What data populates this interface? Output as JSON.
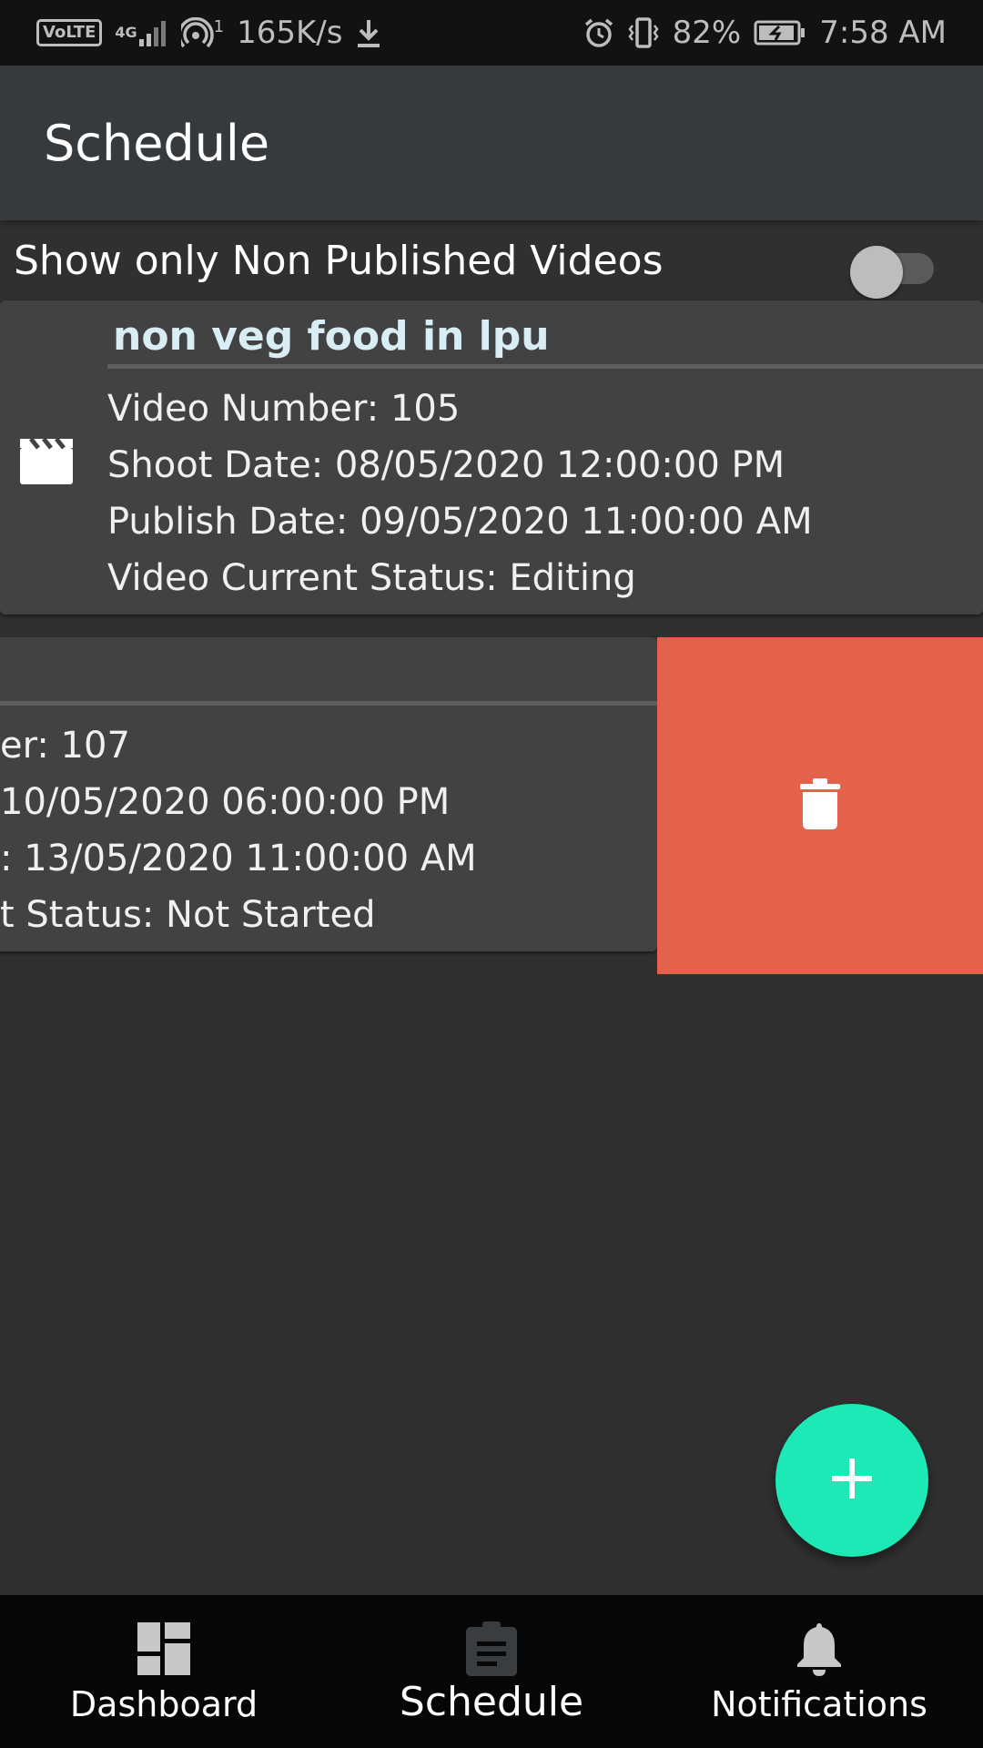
{
  "status_bar": {
    "volte": "VoLTE",
    "network": "4G",
    "hotspot_count": "1",
    "speed": "165K/s",
    "battery": "82%",
    "time": "7:58 AM"
  },
  "app_bar": {
    "title": "Schedule"
  },
  "filter": {
    "label": "Show only Non Published Videos",
    "enabled": false
  },
  "videos": [
    {
      "title": "non veg food in lpu",
      "number_line": "Video Number: 105",
      "shoot_line": "Shoot Date: 08/05/2020 12:00:00 PM",
      "publish_line": "Publish Date: 09/05/2020 11:00:00 AM",
      "status_line": "Video Current Status: Editing"
    },
    {
      "title": "",
      "number_line": "er: 107",
      "shoot_line": "10/05/2020 06:00:00 PM",
      "publish_line": ": 13/05/2020 11:00:00 AM",
      "status_line": "t Status: Not Started"
    }
  ],
  "colors": {
    "accent": "#1de9b6",
    "delete": "#e4624c",
    "title_text": "#d8eef4"
  },
  "nav": [
    {
      "label": "Dashboard",
      "icon": "dashboard-icon"
    },
    {
      "label": "Schedule",
      "icon": "clipboard-icon",
      "active": true
    },
    {
      "label": "Notifications",
      "icon": "bell-icon"
    }
  ]
}
